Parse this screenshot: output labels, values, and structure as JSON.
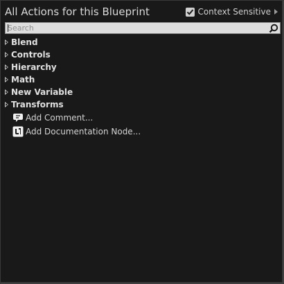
{
  "window": {
    "title": "All Actions for this Blueprint"
  },
  "context_sensitive": {
    "label": "Context Sensitive",
    "checked": true
  },
  "search": {
    "placeholder": "Search",
    "value": ""
  },
  "categories": [
    {
      "label": "Blend",
      "icon": "expand-triangle-icon"
    },
    {
      "label": "Controls",
      "icon": "expand-triangle-icon"
    },
    {
      "label": "Hierarchy",
      "icon": "expand-triangle-icon"
    },
    {
      "label": "Math",
      "icon": "expand-triangle-icon"
    },
    {
      "label": "New Variable",
      "icon": "expand-triangle-icon"
    },
    {
      "label": "Transforms",
      "icon": "expand-triangle-icon"
    }
  ],
  "actions": [
    {
      "label": "Add Comment...",
      "icon": "comment-icon"
    },
    {
      "label": "Add Documentation Node...",
      "icon": "unreal-logo-icon"
    }
  ],
  "colors": {
    "panel_bg": "#191919",
    "text": "#dcdcdc",
    "search_bg": "#dedede"
  }
}
